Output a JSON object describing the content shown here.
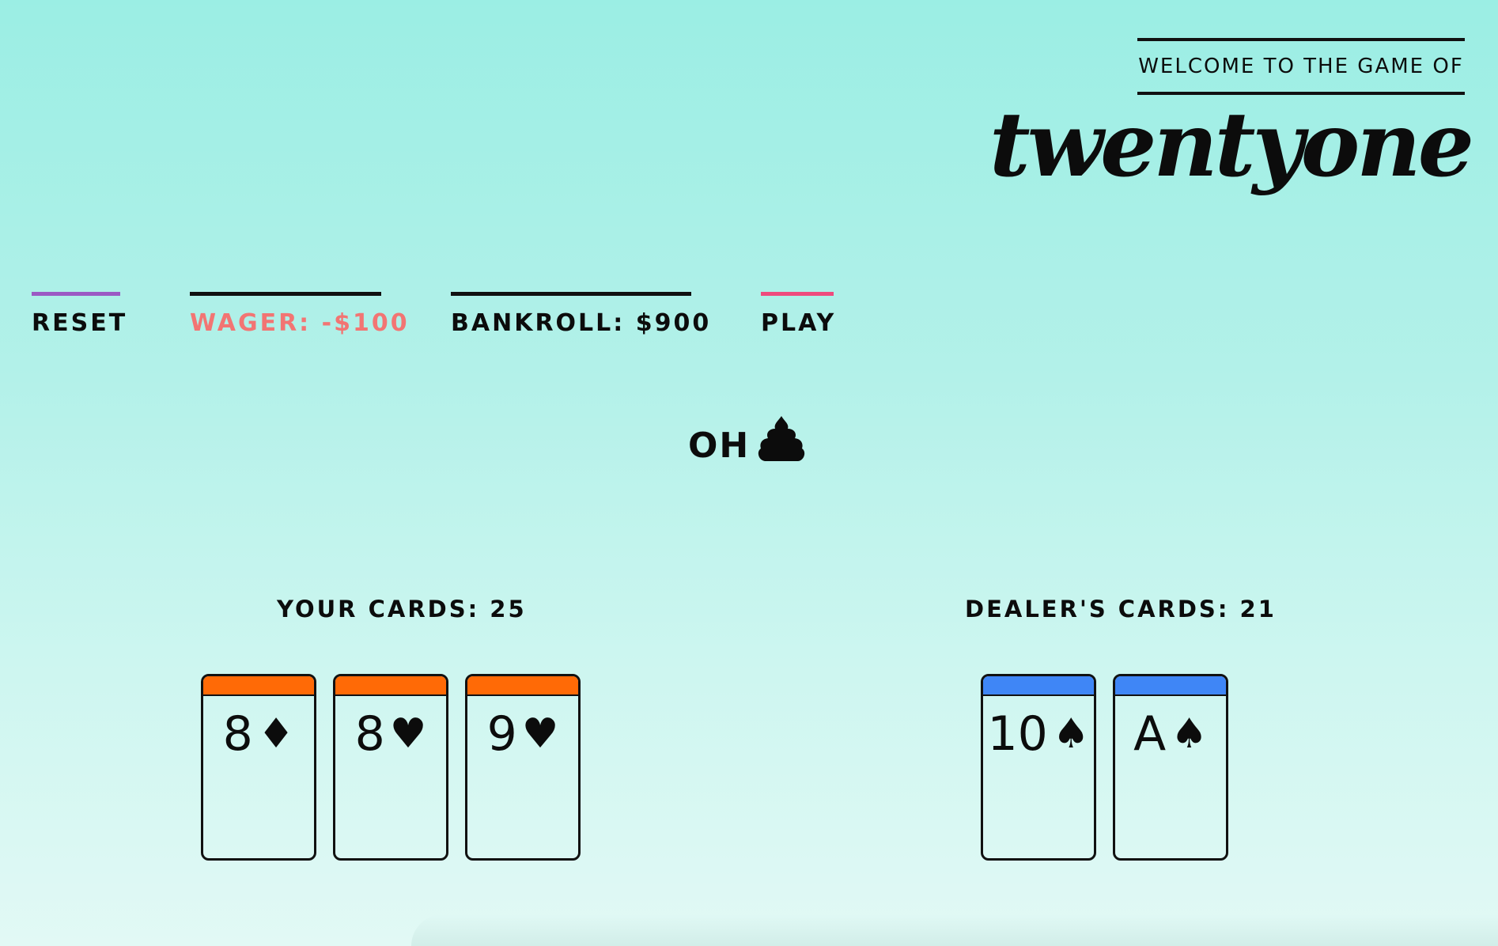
{
  "header": {
    "welcome": "WELCOME TO THE GAME OF",
    "logo": "twentyone"
  },
  "nav": {
    "reset": "RESET",
    "wager": "WAGER: -$100",
    "bankroll": "BANKROLL: $900",
    "play": "PLAY"
  },
  "status": {
    "text": "OH",
    "icon": "poop-icon"
  },
  "player": {
    "title": "YOUR CARDS: 25",
    "accent": "#ff6a06",
    "cards": [
      {
        "rank": "8",
        "suit": "♦",
        "suit_name": "diamonds"
      },
      {
        "rank": "8",
        "suit": "♥",
        "suit_name": "hearts"
      },
      {
        "rank": "9",
        "suit": "♥",
        "suit_name": "hearts"
      }
    ]
  },
  "dealer": {
    "title": "DEALER'S CARDS: 21",
    "accent": "#3f86f6",
    "cards": [
      {
        "rank": "10",
        "suit": "♠",
        "suit_name": "spades"
      },
      {
        "rank": "A",
        "suit": "♠",
        "suit_name": "spades"
      }
    ]
  },
  "colors": {
    "reset_accent": "#9b59c4",
    "play_accent": "#ef4b7d",
    "wager_text": "#f27573",
    "background_top": "#9beee4",
    "background_bottom": "#e2f9f5"
  }
}
